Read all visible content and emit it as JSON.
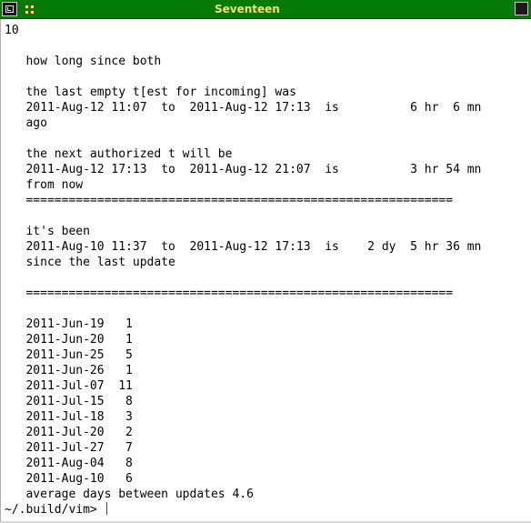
{
  "window": {
    "title": "Seventeen"
  },
  "terminal": {
    "lines": [
      "10",
      "",
      "   how long since both",
      "",
      "   the last empty t[est for incoming] was",
      "   2011-Aug-12 11:07  to  2011-Aug-12 17:13  is          6 hr  6 mn",
      "   ago",
      "",
      "   the next authorized t will be",
      "   2011-Aug-12 17:13  to  2011-Aug-12 21:07  is          3 hr 54 mn",
      "   from now",
      "   ============================================================",
      "",
      "   it's been",
      "   2011-Aug-10 11:37  to  2011-Aug-12 17:13  is    2 dy  5 hr 36 mn",
      "   since the last update",
      "",
      "   ============================================================",
      "",
      "   2011-Jun-19   1",
      "   2011-Jun-20   1",
      "   2011-Jun-25   5",
      "   2011-Jun-26   1",
      "   2011-Jul-07  11",
      "   2011-Jul-15   8",
      "   2011-Jul-18   3",
      "   2011-Jul-20   2",
      "   2011-Jul-27   7",
      "   2011-Aug-04   8",
      "   2011-Aug-10   6",
      "   average days between updates 4.6"
    ],
    "prompt": "~/.build/vim> "
  }
}
